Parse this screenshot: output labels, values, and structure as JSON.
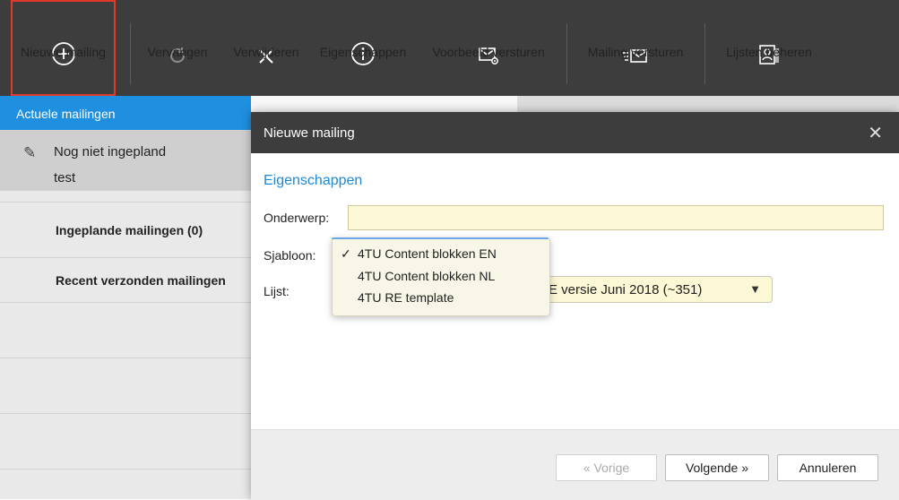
{
  "toolbar": {
    "items": [
      {
        "label": "Nieuwe mailing",
        "icon": "plus-circle-icon",
        "state": "active"
      },
      {
        "label": "Vervangen",
        "icon": "refresh-icon",
        "state": "disabled"
      },
      {
        "label": "Verwijderen",
        "icon": "close-icon",
        "state": "enabled"
      },
      {
        "label": "Eigenschappen",
        "icon": "info-icon",
        "state": "enabled"
      },
      {
        "label": "Voorbeeld versturen",
        "icon": "mail-preview-icon",
        "state": "enabled"
      },
      {
        "label": "Mailing versturen",
        "icon": "mail-send-icon",
        "state": "enabled"
      },
      {
        "label": "Lijsten beheren",
        "icon": "contacts-list-icon",
        "state": "enabled"
      }
    ]
  },
  "sidebar": {
    "header": "Actuele mailingen",
    "draft": {
      "status": "Nog niet ingepland",
      "name": "test"
    },
    "groups": [
      "Ingeplande mailingen (0)",
      "Recent verzonden mailingen"
    ]
  },
  "dialog": {
    "title": "Nieuwe mailing",
    "section_title": "Eigenschappen",
    "subject_label": "Onderwerp:",
    "subject_value": "",
    "template_label": "Sjabloon:",
    "template_options": [
      "4TU Content blokken EN",
      "4TU Content blokken NL",
      "4TU RE template"
    ],
    "template_selected": "4TU Content blokken EN",
    "list_label": "Lijst:",
    "list_value": "E versie Juni 2018 (~351)",
    "buttons": {
      "prev": "« Vorige",
      "next": "Volgende »",
      "cancel": "Annuleren"
    }
  },
  "colors": {
    "toolbar_bg": "#3d3d3d",
    "accent": "#1f8fe0",
    "highlight_border": "#e03a2a",
    "input_bg": "#fcf7d4"
  }
}
